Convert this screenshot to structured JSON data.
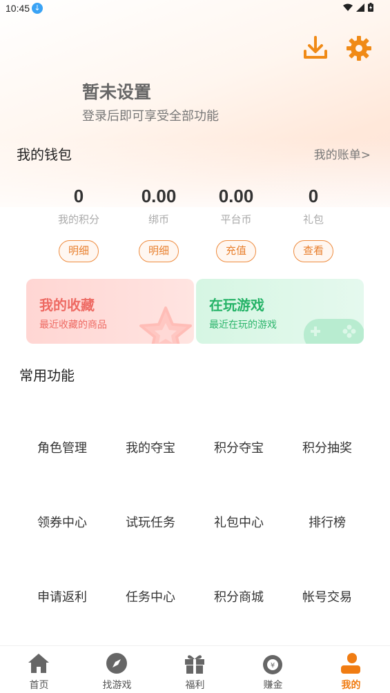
{
  "status": {
    "time": "10:45"
  },
  "profile": {
    "name": "暂未设置",
    "subtitle": "登录后即可享受全部功能"
  },
  "icons": {
    "download": "download-icon",
    "settings": "gear-icon"
  },
  "wallet": {
    "title": "我的钱包",
    "bill_link": "我的账单>",
    "items": [
      {
        "value": "0",
        "label": "我的积分",
        "button": "明细"
      },
      {
        "value": "0.00",
        "label": "绑币",
        "button": "明细"
      },
      {
        "value": "0.00",
        "label": "平台币",
        "button": "充值"
      },
      {
        "value": "0",
        "label": "礼包",
        "button": "查看"
      }
    ]
  },
  "cards": {
    "favorites": {
      "title": "我的收藏",
      "subtitle": "最近收藏的商品"
    },
    "playing": {
      "title": "在玩游戏",
      "subtitle": "最近在玩的游戏"
    }
  },
  "functions": {
    "title": "常用功能",
    "items": [
      "角色管理",
      "我的夺宝",
      "积分夺宝",
      "积分抽奖",
      "领券中心",
      "试玩任务",
      "礼包中心",
      "排行榜",
      "申请返利",
      "任务中心",
      "积分商城",
      "帐号交易"
    ]
  },
  "nav": {
    "items": [
      {
        "label": "首页",
        "icon": "home-icon"
      },
      {
        "label": "找游戏",
        "icon": "compass-icon"
      },
      {
        "label": "福利",
        "icon": "gift-icon"
      },
      {
        "label": "赚金",
        "icon": "money-bag-icon"
      },
      {
        "label": "我的",
        "icon": "user-icon"
      }
    ],
    "active_index": 4
  },
  "colors": {
    "accent": "#f07c12",
    "fav": "#ee6a63",
    "play": "#25b367"
  }
}
